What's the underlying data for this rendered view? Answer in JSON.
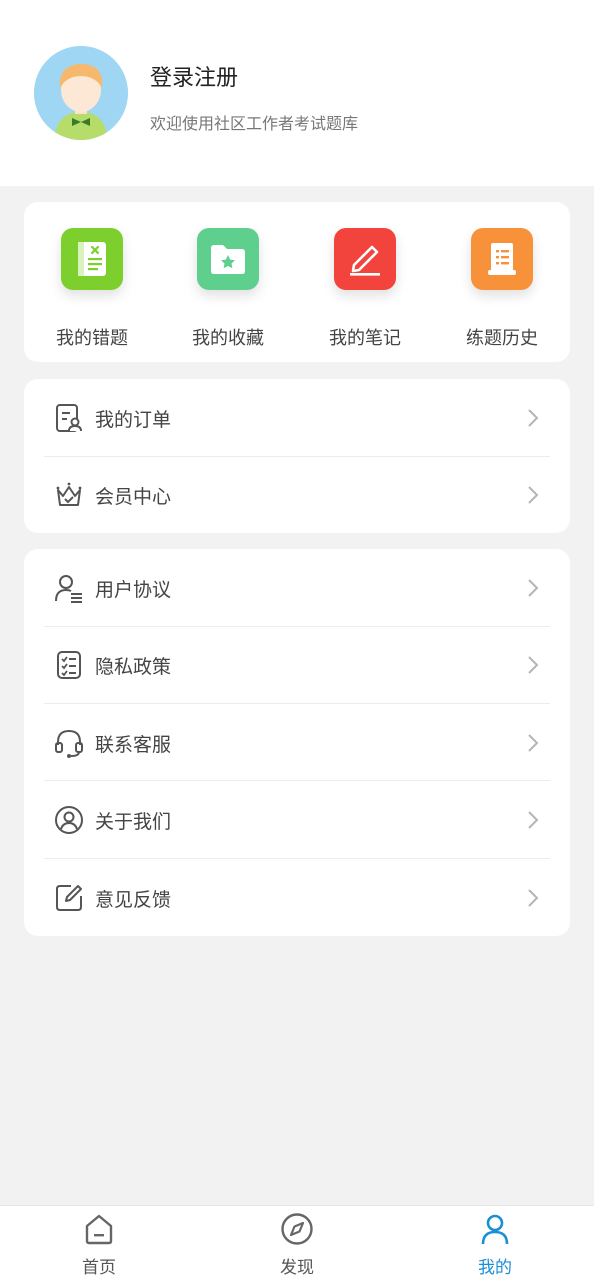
{
  "profile": {
    "name": "登录注册",
    "subtitle": "欢迎使用社区工作者考试题库"
  },
  "quick_actions": [
    {
      "label": "我的错题",
      "icon": "wrong-questions-book-icon",
      "color": "#7ccf2c"
    },
    {
      "label": "我的收藏",
      "icon": "favorite-folder-star-icon",
      "color": "#5fcf8e"
    },
    {
      "label": "我的笔记",
      "icon": "note-pencil-icon",
      "color": "#f2443c"
    },
    {
      "label": "练题历史",
      "icon": "history-scroll-icon",
      "color": "#f7913a"
    }
  ],
  "menu_group_1": [
    {
      "label": "我的订单",
      "icon": "order-document-icon"
    },
    {
      "label": "会员中心",
      "icon": "crown-icon"
    }
  ],
  "menu_group_2": [
    {
      "label": "用户协议",
      "icon": "user-agreement-icon"
    },
    {
      "label": "隐私政策",
      "icon": "privacy-checklist-icon"
    },
    {
      "label": "联系客服",
      "icon": "headset-icon"
    },
    {
      "label": "关于我们",
      "icon": "user-circle-icon"
    },
    {
      "label": "意见反馈",
      "icon": "edit-feedback-icon"
    }
  ],
  "tabbar": [
    {
      "label": "首页",
      "icon": "home-icon",
      "active": false
    },
    {
      "label": "发现",
      "icon": "compass-icon",
      "active": false
    },
    {
      "label": "我的",
      "icon": "person-icon",
      "active": true
    }
  ],
  "colors": {
    "accent": "#1a8fd6",
    "background": "#f2f2f2"
  }
}
